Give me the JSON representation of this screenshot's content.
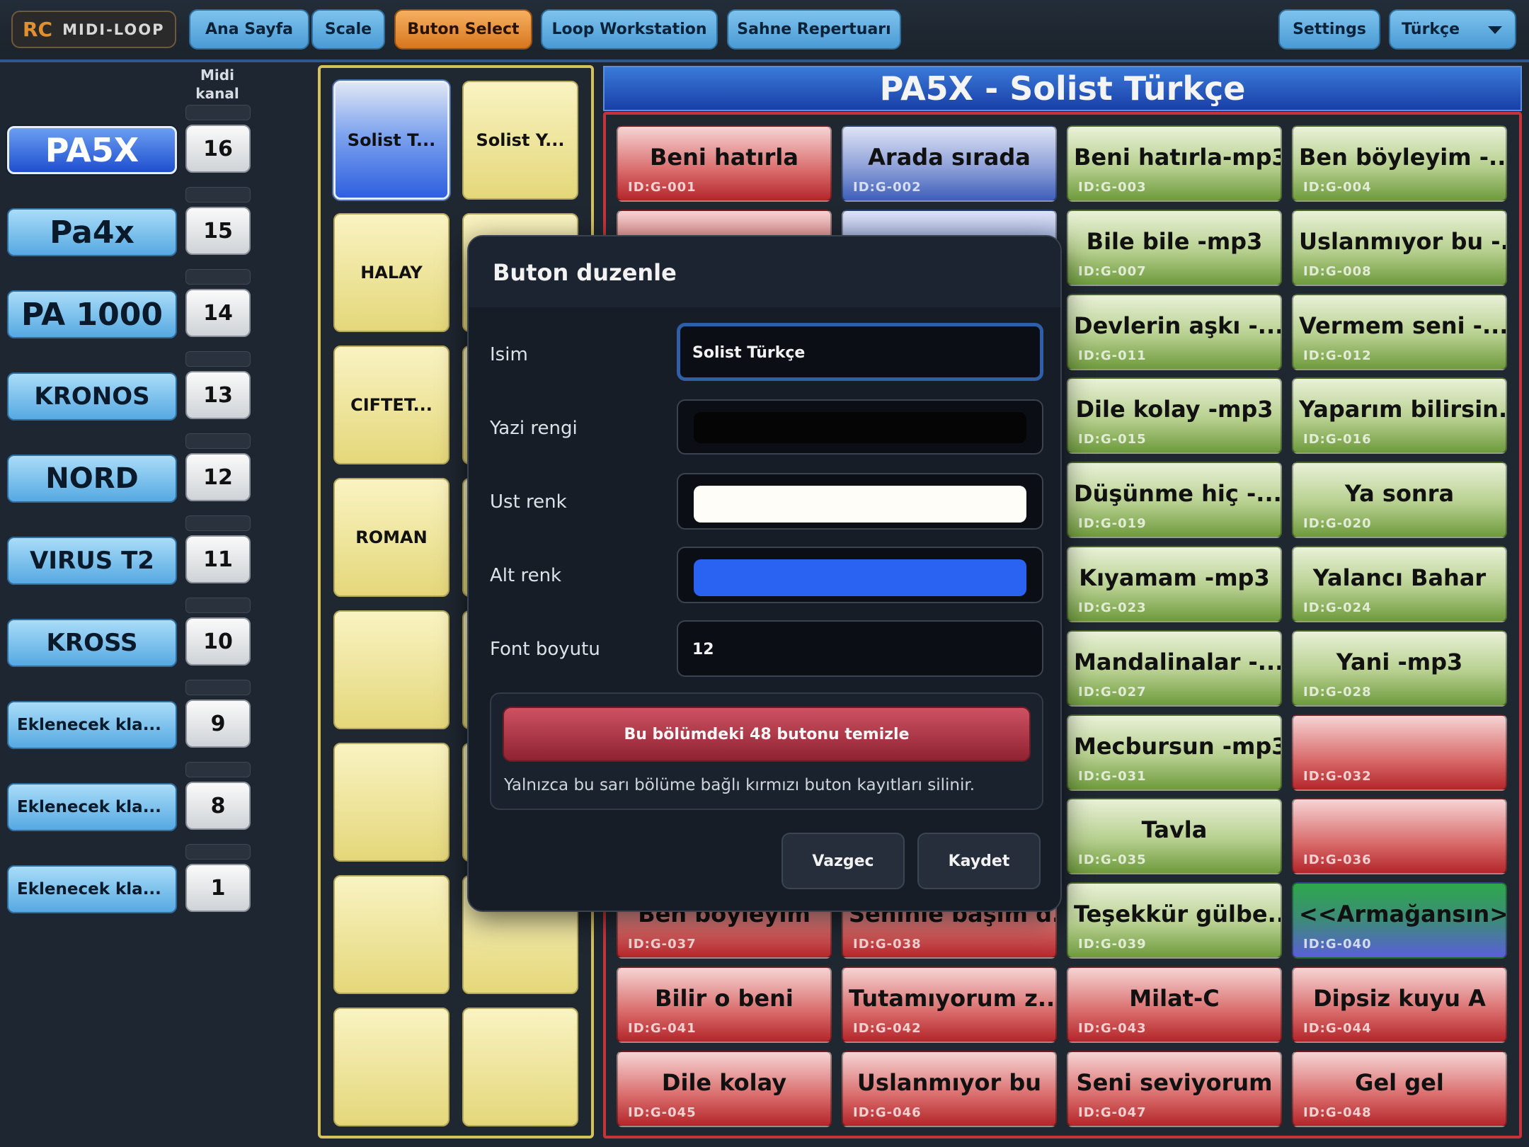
{
  "app": {
    "logo_short": "RC",
    "logo_name": "MIDI-LOOP"
  },
  "nav": [
    "Ana Sayfa",
    "Scale",
    "Buton Select",
    "Loop Workstation",
    "Sahne Repertuarı"
  ],
  "nav_active": "Buton Select",
  "settings_label": "Settings",
  "language": "Türkçe",
  "midi_header_line1": "Midi",
  "midi_header_line2": "kanal",
  "devices": [
    {
      "name": "PA5X",
      "channel": "16",
      "selected": true
    },
    {
      "name": "Pa4x",
      "channel": "15"
    },
    {
      "name": "PA 1000",
      "channel": "14"
    },
    {
      "name": "KRONOS",
      "channel": "13"
    },
    {
      "name": "NORD",
      "channel": "12"
    },
    {
      "name": "VIRUS T2",
      "channel": "11"
    },
    {
      "name": "KROSS",
      "channel": "10"
    },
    {
      "name": "Eklenecek kla...",
      "channel": "9"
    },
    {
      "name": "Eklenecek kla...",
      "channel": "8"
    },
    {
      "name": "Eklenecek kla...",
      "channel": "1"
    }
  ],
  "sections": [
    {
      "label": "Solist T...",
      "selected": true
    },
    {
      "label": "Solist Y..."
    },
    {
      "label": "HALAY"
    },
    {
      "label": ""
    },
    {
      "label": "CIFTET..."
    },
    {
      "label": ""
    },
    {
      "label": "ROMAN"
    },
    {
      "label": ""
    },
    {
      "label": ""
    },
    {
      "label": ""
    },
    {
      "label": ""
    },
    {
      "label": ""
    },
    {
      "label": ""
    },
    {
      "label": ""
    },
    {
      "label": ""
    },
    {
      "label": ""
    }
  ],
  "panel_title": "PA5X - Solist Türkçe",
  "grid_buttons": [
    {
      "name": "Beni hatırla",
      "id": "ID:G-001",
      "color": "red"
    },
    {
      "name": "Arada sırada",
      "id": "ID:G-002",
      "color": "blue"
    },
    {
      "name": "Beni hatırla-mp3",
      "id": "ID:G-003",
      "color": "green"
    },
    {
      "name": "Ben böyleyim -...",
      "id": "ID:G-004",
      "color": "green"
    },
    {
      "name": "",
      "id": "",
      "color": "red"
    },
    {
      "name": "",
      "id": "",
      "color": "blue"
    },
    {
      "name": "Bile bile -mp3",
      "id": "ID:G-007",
      "color": "green"
    },
    {
      "name": "Uslanmıyor bu -...",
      "id": "ID:G-008",
      "color": "green"
    },
    {
      "name": "",
      "id": "",
      "color": "red"
    },
    {
      "name": "",
      "id": "",
      "color": "red"
    },
    {
      "name": "Devlerin aşkı -...",
      "id": "ID:G-011",
      "color": "green"
    },
    {
      "name": "Vermem seni -...",
      "id": "ID:G-012",
      "color": "green"
    },
    {
      "name": "",
      "id": "",
      "color": "red"
    },
    {
      "name": "",
      "id": "",
      "color": "red"
    },
    {
      "name": "Dile kolay -mp3",
      "id": "ID:G-015",
      "color": "green"
    },
    {
      "name": "Yaparım bilirsin...",
      "id": "ID:G-016",
      "color": "green"
    },
    {
      "name": "",
      "id": "",
      "color": "red"
    },
    {
      "name": "",
      "id": "",
      "color": "red"
    },
    {
      "name": "Düşünme hiç -...",
      "id": "ID:G-019",
      "color": "green"
    },
    {
      "name": "Ya sonra",
      "id": "ID:G-020",
      "color": "green"
    },
    {
      "name": "",
      "id": "",
      "color": "red"
    },
    {
      "name": "",
      "id": "",
      "color": "red"
    },
    {
      "name": "Kıyamam -mp3",
      "id": "ID:G-023",
      "color": "green"
    },
    {
      "name": "Yalancı Bahar",
      "id": "ID:G-024",
      "color": "green"
    },
    {
      "name": "",
      "id": "",
      "color": "red"
    },
    {
      "name": "",
      "id": "",
      "color": "red"
    },
    {
      "name": "Mandalinalar -...",
      "id": "ID:G-027",
      "color": "green"
    },
    {
      "name": "Yani -mp3",
      "id": "ID:G-028",
      "color": "green"
    },
    {
      "name": "",
      "id": "",
      "color": "red"
    },
    {
      "name": "",
      "id": "",
      "color": "red"
    },
    {
      "name": "Mecbursun -mp3",
      "id": "ID:G-031",
      "color": "green"
    },
    {
      "name": "",
      "id": "ID:G-032",
      "color": "red"
    },
    {
      "name": "",
      "id": "",
      "color": "red"
    },
    {
      "name": "",
      "id": "",
      "color": "red"
    },
    {
      "name": "Tavla",
      "id": "ID:G-035",
      "color": "green"
    },
    {
      "name": "",
      "id": "ID:G-036",
      "color": "red"
    },
    {
      "name": "Ben böyleyim",
      "id": "ID:G-037",
      "color": "red"
    },
    {
      "name": "Seninle başım d...",
      "id": "ID:G-038",
      "color": "red"
    },
    {
      "name": "Teşekkür gülbe...",
      "id": "ID:G-039",
      "color": "green"
    },
    {
      "name": "<<Armağansın>>",
      "id": "ID:G-040",
      "color": "special"
    },
    {
      "name": "Bilir o beni",
      "id": "ID:G-041",
      "color": "red"
    },
    {
      "name": "Tutamıyorum z...",
      "id": "ID:G-042",
      "color": "red"
    },
    {
      "name": "Milat-C",
      "id": "ID:G-043",
      "color": "red"
    },
    {
      "name": "Dipsiz kuyu A",
      "id": "ID:G-044",
      "color": "red"
    },
    {
      "name": "Dile kolay",
      "id": "ID:G-045",
      "color": "red"
    },
    {
      "name": "Uslanmıyor bu",
      "id": "ID:G-046",
      "color": "red"
    },
    {
      "name": "Seni seviyorum",
      "id": "ID:G-047",
      "color": "red"
    },
    {
      "name": "Gel gel",
      "id": "ID:G-048",
      "color": "red"
    }
  ],
  "dialog": {
    "title": "Buton duzenle",
    "name_label": "Isim",
    "name_value": "Solist Türkçe",
    "text_color_label": "Yazi rengi",
    "text_color": "#050505",
    "top_color_label": "Ust renk",
    "top_color": "#fffdf7",
    "bottom_color_label": "Alt renk",
    "bottom_color": "#2a62f2",
    "font_size_label": "Font boyutu",
    "font_size_value": "12",
    "clear_button": "Bu bölümdeki 48 butonu temizle",
    "clear_note": "Yalnızca bu sarı bölüme bağlı kırmızı buton kayıtları silinir.",
    "cancel": "Vazgec",
    "save": "Kaydet"
  }
}
